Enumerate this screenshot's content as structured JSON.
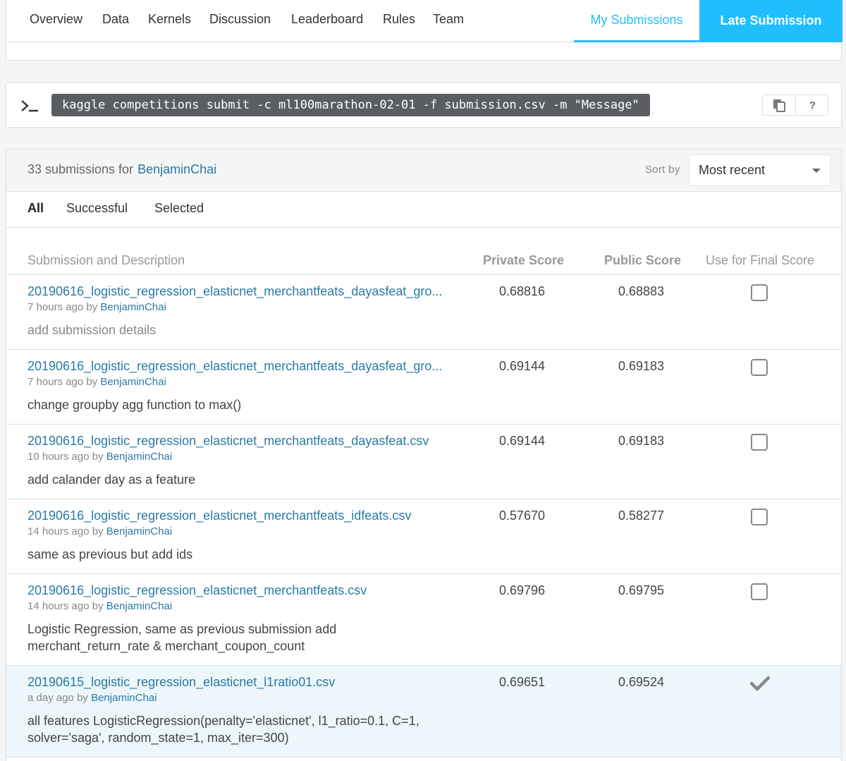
{
  "nav": {
    "tabs": [
      "Overview",
      "Data",
      "Kernels",
      "Discussion",
      "Leaderboard",
      "Rules",
      "Team"
    ],
    "my_submissions": "My Submissions",
    "late_submission": "Late Submission"
  },
  "api": {
    "command": "kaggle competitions submit -c ml100marathon-02-01 -f submission.csv -m \"Message\"",
    "help_label": "?",
    "icons": [
      "terminal-prompt-icon",
      "copy-icon"
    ]
  },
  "panel": {
    "count_text": "33 submissions for",
    "user": "BenjaminChai",
    "sort_label": "Sort by",
    "sort_value": "Most recent",
    "filters": [
      "All",
      "Successful",
      "Selected"
    ],
    "active_filter": "All",
    "columns": {
      "submission": "Submission and Description",
      "private": "Private Score",
      "public": "Public Score",
      "final": "Use for Final Score"
    }
  },
  "submissions": [
    {
      "file": "20190616_logistic_regression_elasticnet_merchantfeats_dayasfeat_gro...",
      "time": "7 hours ago",
      "by": "by",
      "user": "BenjaminChai",
      "description": "add submission details",
      "private": "0.68816",
      "public": "0.68883",
      "selected": false
    },
    {
      "file": "20190616_logistic_regression_elasticnet_merchantfeats_dayasfeat_gro...",
      "time": "7 hours ago",
      "by": "by",
      "user": "BenjaminChai",
      "description": "change groupby agg function to max()",
      "private": "0.69144",
      "public": "0.69183",
      "selected": false
    },
    {
      "file": "20190616_logistic_regression_elasticnet_merchantfeats_dayasfeat.csv",
      "time": "10 hours ago",
      "by": "by",
      "user": "BenjaminChai",
      "description": "add calander day as a feature",
      "private": "0.69144",
      "public": "0.69183",
      "selected": false
    },
    {
      "file": "20190616_logistic_regression_elasticnet_merchantfeats_idfeats.csv",
      "time": "14 hours ago",
      "by": "by",
      "user": "BenjaminChai",
      "description": "same as previous but add ids",
      "private": "0.57670",
      "public": "0.58277",
      "selected": false
    },
    {
      "file": "20190616_logistic_regression_elasticnet_merchantfeats.csv",
      "time": "14 hours ago",
      "by": "by",
      "user": "BenjaminChai",
      "description": "Logistic Regression, same as previous submission add merchant_return_rate & merchant_coupon_count",
      "private": "0.69796",
      "public": "0.69795",
      "selected": false
    },
    {
      "file": "20190615_logistic_regression_elasticnet_l1ratio01.csv",
      "time": "a day ago",
      "by": "by",
      "user": "BenjaminChai",
      "description": "all features LogisticRegression(penalty='elasticnet', l1_ratio=0.1, C=1, solver='saga', random_state=1, max_iter=300)",
      "private": "0.69651",
      "public": "0.69524",
      "selected": true
    }
  ],
  "colors": {
    "accent": "#20beff",
    "link": "#2a79a5",
    "selected_row": "#edf6fa"
  }
}
